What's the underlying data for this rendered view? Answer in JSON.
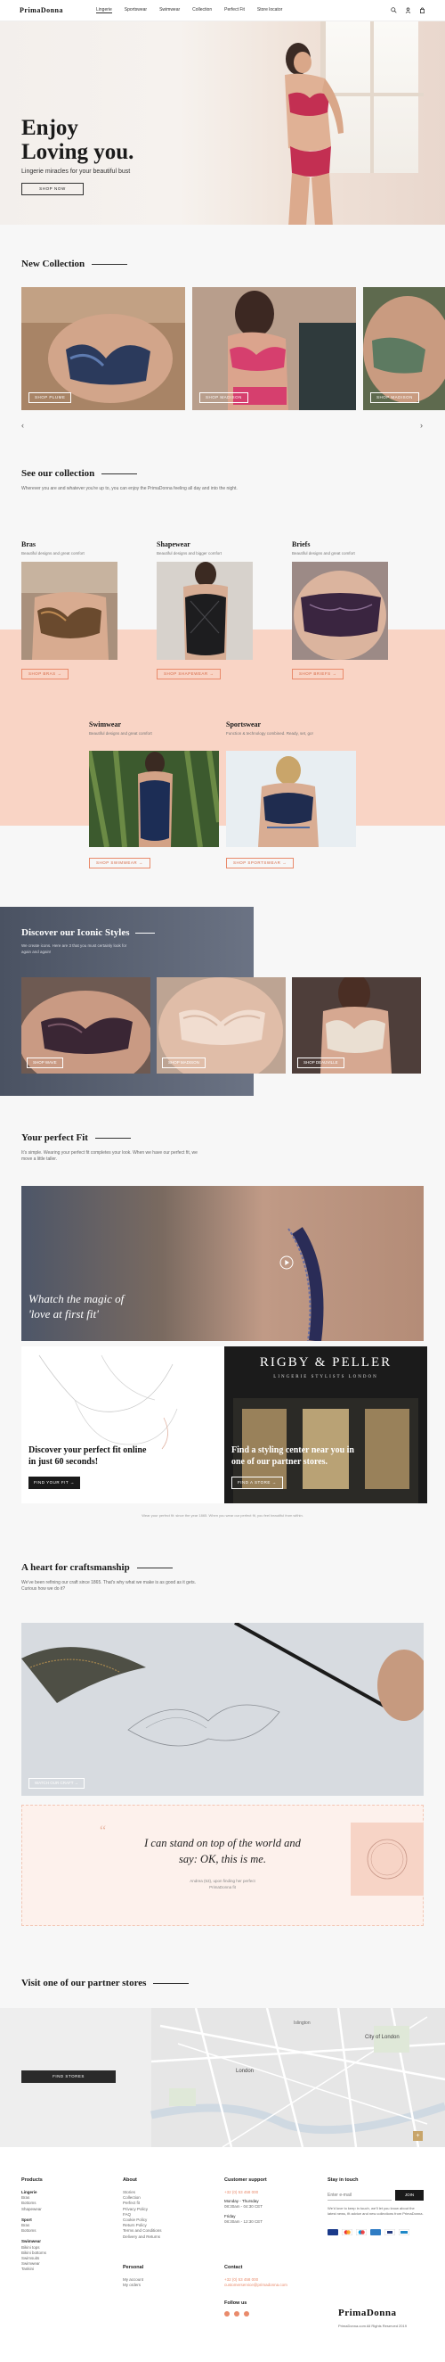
{
  "header": {
    "logo": "PrimaDonna",
    "nav": [
      "Lingerie",
      "Sportswear",
      "Swimwear",
      "Collection",
      "Perfect Fit",
      "Store locator"
    ]
  },
  "hero": {
    "title_line1": "Enjoy",
    "title_line2": "Loving you.",
    "subtitle": "Lingerie miracles for your beautiful bust",
    "button": "SHOP NOW"
  },
  "new_collection": {
    "title": "New Collection",
    "items": [
      {
        "tag": "SHOP PLUME"
      },
      {
        "tag": "SHOP MADISON"
      },
      {
        "tag": "SHOP MADISON"
      }
    ]
  },
  "see_collection": {
    "title": "See our collection",
    "desc": "Wherever you are and whatever you're up to, you can enjoy the PrimaDonna feeling all day and into the night."
  },
  "categories": [
    {
      "name": "Bras",
      "desc": "Beautiful designs and great comfort",
      "tag": "SHOP BRAS"
    },
    {
      "name": "Shapewear",
      "desc": "Beautiful designs and bigger comfort",
      "tag": "SHOP SHAPEWEAR"
    },
    {
      "name": "Briefs",
      "desc": "Beautiful designs and great comfort",
      "tag": "SHOP BRIEFS"
    },
    {
      "name": "Swimwear",
      "desc": "Beautiful designs and great comfort",
      "tag": "SHOP SWIMWEAR"
    },
    {
      "name": "Sportswear",
      "desc": "Function & technology combined. Ready, set, go!",
      "tag": "SHOP SPORTSWEAR"
    }
  ],
  "iconic": {
    "title": "Discover our Iconic Styles",
    "desc": "We create icons. Here are 3 that you must certainly look for again and again!",
    "items": [
      {
        "tag": "SHOP WAVE"
      },
      {
        "tag": "SHOP MADISON"
      },
      {
        "tag": "SHOP DEAUVILLE"
      }
    ]
  },
  "perfect_fit": {
    "title": "Your perfect Fit",
    "desc": "It's simple. Wearing your perfect fit completes your look. When we have our perfect fit, we move a little taller.",
    "video_caption_l1": "Whatch the magic of",
    "video_caption_l2": "'love at first fit'",
    "card1_l1": "Discover your perfect fit online",
    "card1_l2": "in just 60 seconds!",
    "card1_btn": "FIND YOUR FIT",
    "card2_brand": "RIGBY & PELLER",
    "card2_brand_sub": "LINGERIE STYLISTS LONDON",
    "card2_l1": "Find a styling center near you in",
    "card2_l2": "one of our partner stores.",
    "card2_btn": "FIND A STORE",
    "footnote": "Wear your perfect fit: since the year 1865. When you wear our perfect fit, you feel beautiful from within."
  },
  "craft": {
    "title": "A heart for craftsmanship",
    "desc": "We've been refining our craft since 1865. That's why what we make is as good as it gets. Curious how we do it?",
    "tag": "WATCH OUR CRAFT"
  },
  "quote": {
    "text_l1": "I can stand on top of the world and",
    "text_l2": "say: OK, this is me.",
    "by_l1": "Andrea (53), upon finding her perfect",
    "by_l2": "PrimaDonna fit"
  },
  "stores": {
    "title": "Visit one of our partner stores",
    "button": "FIND STORES",
    "map_labels": [
      "City of London",
      "London",
      "Islington"
    ]
  },
  "footer": {
    "products_title": "Products",
    "products": {
      "groups": [
        {
          "head": "Lingerie",
          "items": [
            "Bras",
            "Bottoms",
            "Shapewear"
          ]
        },
        {
          "head": "Sport",
          "items": [
            "Bras",
            "Bottoms"
          ]
        },
        {
          "head": "Swimwear",
          "items": [
            "Bikini tops",
            "Bikini bottoms",
            "Swimsuits",
            "Swimwear",
            "Tankini"
          ]
        }
      ]
    },
    "about_title": "About",
    "about": [
      "Stories",
      "Collection",
      "Perfect fit",
      "Privacy Policy",
      "FAQ",
      "Cookie Policy",
      "Return Policy",
      "Terms and Conditions",
      "Delivery and Returns"
    ],
    "personal_title": "Personal",
    "personal": [
      "My account",
      "My orders"
    ],
    "support_title": "Customer support",
    "support": [
      "+32 (0) 53 458 000",
      "Monday - Thursday",
      "08:30am - 04:30 CET",
      "Friday",
      "08:30am - 12:30 CET"
    ],
    "contact_title": "Contact",
    "contact": [
      "+32 (0) 53 458 000",
      "customerservice@primadonna.com"
    ],
    "follow_title": "Follow us",
    "touch_title": "Stay in touch",
    "email_placeholder": "Enter e-mail",
    "join": "JOIN",
    "touch_desc": "We'd love to keep in touch, we'll let you know about the latest news, fit advice and new collections from PrimaDonna.",
    "logo": "PrimaDonna",
    "copyright": "PrimaDonna.com All Rights Reserved 2019"
  },
  "colors": {
    "accent": "#e98a6b",
    "pink_band": "#f9d4c5",
    "slate": "#525a6b"
  }
}
